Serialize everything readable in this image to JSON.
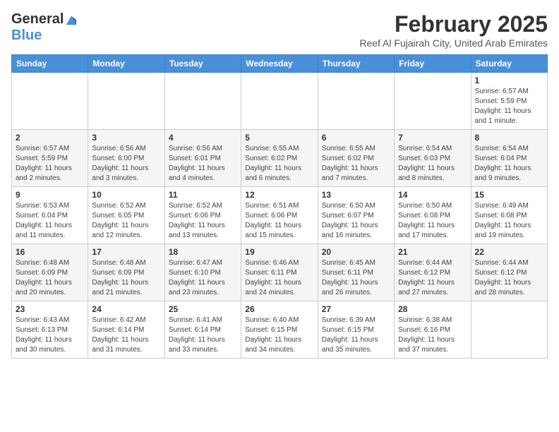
{
  "header": {
    "logo_general": "General",
    "logo_blue": "Blue",
    "month_year": "February 2025",
    "location": "Reef Al Fujairah City, United Arab Emirates"
  },
  "columns": [
    "Sunday",
    "Monday",
    "Tuesday",
    "Wednesday",
    "Thursday",
    "Friday",
    "Saturday"
  ],
  "weeks": [
    {
      "days": [
        {
          "num": "",
          "info": ""
        },
        {
          "num": "",
          "info": ""
        },
        {
          "num": "",
          "info": ""
        },
        {
          "num": "",
          "info": ""
        },
        {
          "num": "",
          "info": ""
        },
        {
          "num": "",
          "info": ""
        },
        {
          "num": "1",
          "info": "Sunrise: 6:57 AM\nSunset: 5:59 PM\nDaylight: 11 hours\nand 1 minute."
        }
      ]
    },
    {
      "days": [
        {
          "num": "2",
          "info": "Sunrise: 6:57 AM\nSunset: 5:59 PM\nDaylight: 11 hours\nand 2 minutes."
        },
        {
          "num": "3",
          "info": "Sunrise: 6:56 AM\nSunset: 6:00 PM\nDaylight: 11 hours\nand 3 minutes."
        },
        {
          "num": "4",
          "info": "Sunrise: 6:56 AM\nSunset: 6:01 PM\nDaylight: 11 hours\nand 4 minutes."
        },
        {
          "num": "5",
          "info": "Sunrise: 6:55 AM\nSunset: 6:02 PM\nDaylight: 11 hours\nand 6 minutes."
        },
        {
          "num": "6",
          "info": "Sunrise: 6:55 AM\nSunset: 6:02 PM\nDaylight: 11 hours\nand 7 minutes."
        },
        {
          "num": "7",
          "info": "Sunrise: 6:54 AM\nSunset: 6:03 PM\nDaylight: 11 hours\nand 8 minutes."
        },
        {
          "num": "8",
          "info": "Sunrise: 6:54 AM\nSunset: 6:04 PM\nDaylight: 11 hours\nand 9 minutes."
        }
      ]
    },
    {
      "days": [
        {
          "num": "9",
          "info": "Sunrise: 6:53 AM\nSunset: 6:04 PM\nDaylight: 11 hours\nand 11 minutes."
        },
        {
          "num": "10",
          "info": "Sunrise: 6:52 AM\nSunset: 6:05 PM\nDaylight: 11 hours\nand 12 minutes."
        },
        {
          "num": "11",
          "info": "Sunrise: 6:52 AM\nSunset: 6:06 PM\nDaylight: 11 hours\nand 13 minutes."
        },
        {
          "num": "12",
          "info": "Sunrise: 6:51 AM\nSunset: 6:06 PM\nDaylight: 11 hours\nand 15 minutes."
        },
        {
          "num": "13",
          "info": "Sunrise: 6:50 AM\nSunset: 6:07 PM\nDaylight: 11 hours\nand 16 minutes."
        },
        {
          "num": "14",
          "info": "Sunrise: 6:50 AM\nSunset: 6:08 PM\nDaylight: 11 hours\nand 17 minutes."
        },
        {
          "num": "15",
          "info": "Sunrise: 6:49 AM\nSunset: 6:08 PM\nDaylight: 11 hours\nand 19 minutes."
        }
      ]
    },
    {
      "days": [
        {
          "num": "16",
          "info": "Sunrise: 6:48 AM\nSunset: 6:09 PM\nDaylight: 11 hours\nand 20 minutes."
        },
        {
          "num": "17",
          "info": "Sunrise: 6:48 AM\nSunset: 6:09 PM\nDaylight: 11 hours\nand 21 minutes."
        },
        {
          "num": "18",
          "info": "Sunrise: 6:47 AM\nSunset: 6:10 PM\nDaylight: 11 hours\nand 23 minutes."
        },
        {
          "num": "19",
          "info": "Sunrise: 6:46 AM\nSunset: 6:11 PM\nDaylight: 11 hours\nand 24 minutes."
        },
        {
          "num": "20",
          "info": "Sunrise: 6:45 AM\nSunset: 6:11 PM\nDaylight: 11 hours\nand 26 minutes."
        },
        {
          "num": "21",
          "info": "Sunrise: 6:44 AM\nSunset: 6:12 PM\nDaylight: 11 hours\nand 27 minutes."
        },
        {
          "num": "22",
          "info": "Sunrise: 6:44 AM\nSunset: 6:12 PM\nDaylight: 11 hours\nand 28 minutes."
        }
      ]
    },
    {
      "days": [
        {
          "num": "23",
          "info": "Sunrise: 6:43 AM\nSunset: 6:13 PM\nDaylight: 11 hours\nand 30 minutes."
        },
        {
          "num": "24",
          "info": "Sunrise: 6:42 AM\nSunset: 6:14 PM\nDaylight: 11 hours\nand 31 minutes."
        },
        {
          "num": "25",
          "info": "Sunrise: 6:41 AM\nSunset: 6:14 PM\nDaylight: 11 hours\nand 33 minutes."
        },
        {
          "num": "26",
          "info": "Sunrise: 6:40 AM\nSunset: 6:15 PM\nDaylight: 11 hours\nand 34 minutes."
        },
        {
          "num": "27",
          "info": "Sunrise: 6:39 AM\nSunset: 6:15 PM\nDaylight: 11 hours\nand 35 minutes."
        },
        {
          "num": "28",
          "info": "Sunrise: 6:38 AM\nSunset: 6:16 PM\nDaylight: 11 hours\nand 37 minutes."
        },
        {
          "num": "",
          "info": ""
        }
      ]
    }
  ]
}
